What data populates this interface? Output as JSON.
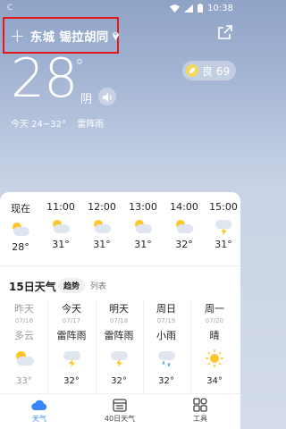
{
  "status_bar": {
    "left": "C",
    "time": "10:38"
  },
  "header": {
    "location": "东城 锡拉胡同"
  },
  "current": {
    "temp": "28",
    "degree": "°",
    "condition": "阴",
    "aqi_label": "良 69",
    "today": "今天 24~32°",
    "today_cond": "雷阵雨"
  },
  "hourly": [
    {
      "time": "现在",
      "temp": "28°",
      "icon": "partly-cloudy-icon"
    },
    {
      "time": "11:00",
      "temp": "31°",
      "icon": "partly-cloudy-icon"
    },
    {
      "time": "12:00",
      "temp": "31°",
      "icon": "partly-cloudy-icon"
    },
    {
      "time": "13:00",
      "temp": "31°",
      "icon": "partly-cloudy-icon"
    },
    {
      "time": "14:00",
      "temp": "32°",
      "icon": "partly-cloudy-icon"
    },
    {
      "time": "15:00",
      "temp": "31°",
      "icon": "thunderstorm-icon"
    }
  ],
  "forecast_title": "15日天气",
  "toggle": {
    "trend": "趋势",
    "list": "列表"
  },
  "days": [
    {
      "name": "昨天",
      "date": "07/16",
      "cond": "多云",
      "temp": "33°",
      "icon": "partly-cloudy-icon",
      "past": true
    },
    {
      "name": "今天",
      "date": "07/17",
      "cond": "雷阵雨",
      "temp": "32°",
      "icon": "thunderstorm-icon",
      "past": false
    },
    {
      "name": "明天",
      "date": "07/18",
      "cond": "雷阵雨",
      "temp": "32°",
      "icon": "thunderstorm-icon",
      "past": false
    },
    {
      "name": "周日",
      "date": "07/19",
      "cond": "小雨",
      "temp": "32°",
      "icon": "light-rain-icon",
      "past": false
    },
    {
      "name": "周一",
      "date": "07/20",
      "cond": "晴",
      "temp": "34°",
      "icon": "sunny-icon",
      "past": false
    }
  ],
  "tabs": [
    {
      "label": "天气",
      "icon": "weather-tab-icon",
      "active": true
    },
    {
      "label": "40日天气",
      "icon": "calendar-tab-icon",
      "active": false
    },
    {
      "label": "工具",
      "icon": "tools-tab-icon",
      "active": false
    }
  ],
  "colors": {
    "accent": "#3a86ff",
    "highlight_box": "#e01b1b",
    "aqi": "#f4d85b"
  }
}
